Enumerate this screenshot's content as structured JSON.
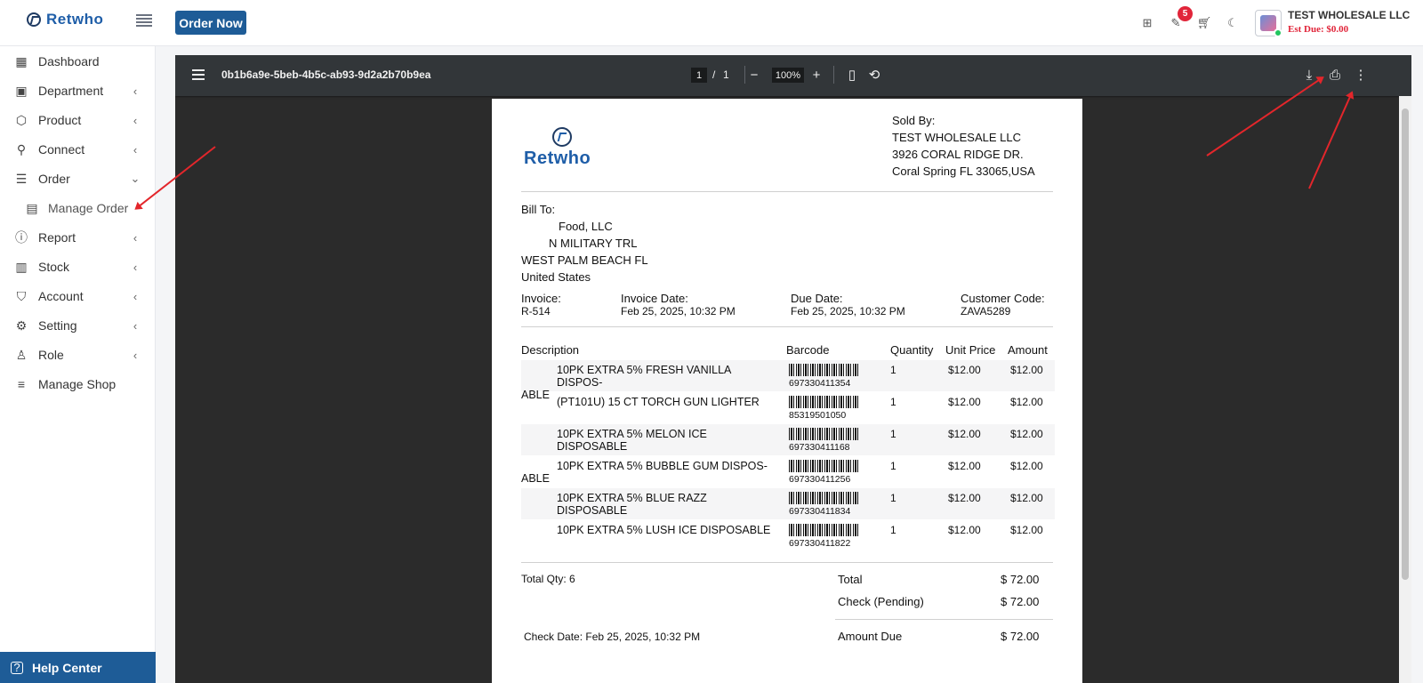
{
  "app": {
    "logo_text": "Retwho",
    "order_now": "Order Now"
  },
  "header": {
    "notification_count": "5",
    "store_name": "TEST WHOLESALE LLC",
    "est_due": "Est Due: $0.00"
  },
  "sidebar": {
    "items": [
      {
        "label": "Dashboard"
      },
      {
        "label": "Department"
      },
      {
        "label": "Product"
      },
      {
        "label": "Connect"
      },
      {
        "label": "Order"
      },
      {
        "label": "Manage Order"
      },
      {
        "label": "Report"
      },
      {
        "label": "Stock"
      },
      {
        "label": "Account"
      },
      {
        "label": "Setting"
      },
      {
        "label": "Role"
      },
      {
        "label": "Manage Shop"
      }
    ],
    "help": "Help Center"
  },
  "pdf": {
    "title": "0b1b6a9e-5beb-4b5c-ab93-9d2a2b70b9ea",
    "page_current": "1",
    "page_sep": "/",
    "page_total": "1",
    "zoom": "100%"
  },
  "invoice": {
    "logo_text": "Retwho",
    "sold_by": {
      "heading": "Sold By:",
      "name": "TEST WHOLESALE LLC",
      "address1": "3926 CORAL RIDGE DR.",
      "address2": "Coral Spring FL 33065,USA"
    },
    "bill_to": {
      "heading": "Bill To:",
      "line1": "Food, LLC",
      "line2": "N MILITARY TRL",
      "line3": "WEST PALM BEACH FL",
      "line4": "United States"
    },
    "meta": {
      "invoice_label": "Invoice:",
      "invoice_value": "R-514",
      "date_label": "Invoice Date:",
      "date_value": "Feb 25, 2025, 10:32 PM",
      "due_label": "Due Date:",
      "due_value": "Feb 25, 2025, 10:32 PM",
      "code_label": "Customer Code:",
      "code_value": "ZAVA5289"
    },
    "columns": {
      "description": "Description",
      "barcode": "Barcode",
      "quantity": "Quantity",
      "unit_price": "Unit Price",
      "amount": "Amount"
    },
    "items": [
      {
        "desc1": "10PK EXTRA 5% FRESH VANILLA DISPOS-",
        "desc2": "ABLE",
        "barcode": "697330411354",
        "qty": "1",
        "unit": "$12.00",
        "amount": "$12.00"
      },
      {
        "desc1": "(PT101U) 15 CT TORCH GUN LIGHTER",
        "desc2": "",
        "barcode": "85319501050",
        "qty": "1",
        "unit": "$12.00",
        "amount": "$12.00"
      },
      {
        "desc1": "10PK EXTRA 5% MELON ICE DISPOSABLE",
        "desc2": "",
        "barcode": "697330411168",
        "qty": "1",
        "unit": "$12.00",
        "amount": "$12.00"
      },
      {
        "desc1": "10PK EXTRA 5% BUBBLE GUM DISPOS-",
        "desc2": "ABLE",
        "barcode": "697330411256",
        "qty": "1",
        "unit": "$12.00",
        "amount": "$12.00"
      },
      {
        "desc1": "10PK EXTRA 5% BLUE RAZZ DISPOSABLE",
        "desc2": "",
        "barcode": "697330411834",
        "qty": "1",
        "unit": "$12.00",
        "amount": "$12.00"
      },
      {
        "desc1": "10PK EXTRA 5% LUSH ICE DISPOSABLE",
        "desc2": "",
        "barcode": "697330411822",
        "qty": "1",
        "unit": "$12.00",
        "amount": "$12.00"
      }
    ],
    "total_qty": "Total Qty: 6",
    "total_label": "Total",
    "total_value": "$ 72.00",
    "check_label": "Check (Pending)",
    "check_value": "$ 72.00",
    "check_date": "Check Date:  Feb 25, 2025, 10:32 PM",
    "due_label": "Amount Due",
    "due_value": "$ 72.00"
  }
}
